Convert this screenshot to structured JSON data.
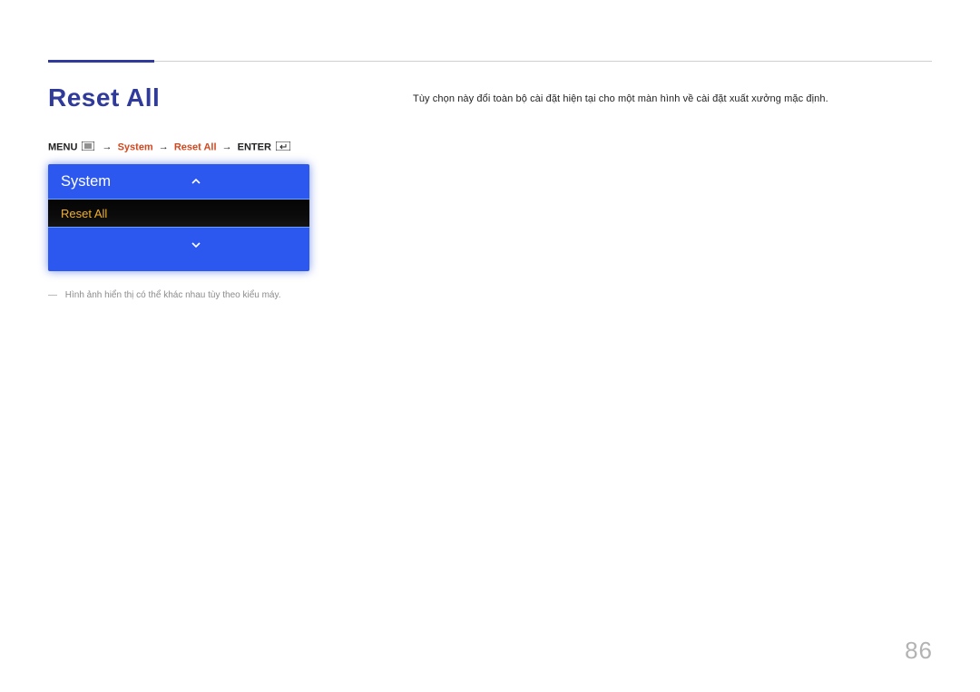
{
  "title": "Reset All",
  "breadcrumb": {
    "menu": "MENU",
    "system": "System",
    "reset_all": "Reset All",
    "enter": "ENTER"
  },
  "osd": {
    "title": "System",
    "selected": "Reset All"
  },
  "note": "Hình ảnh hiển thị có thể khác nhau tùy theo kiểu máy.",
  "description": "Tùy chọn này đổi toàn bộ cài đặt hiện tại cho một màn hình về cài đặt xuất xưởng mặc định.",
  "page_no": "86"
}
